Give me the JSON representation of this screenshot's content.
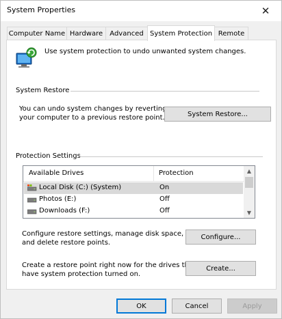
{
  "window": {
    "title": "System Properties",
    "close_glyph": "✕"
  },
  "tabs": [
    {
      "label": "Computer Name",
      "active": false
    },
    {
      "label": "Hardware",
      "active": false
    },
    {
      "label": "Advanced",
      "active": false
    },
    {
      "label": "System Protection",
      "active": true
    },
    {
      "label": "Remote",
      "active": false
    }
  ],
  "intro": {
    "icon": "system-protection-shield-icon",
    "text": "Use system protection to undo unwanted system changes."
  },
  "system_restore": {
    "group_label": "System Restore",
    "description_line1": "You can undo system changes by reverting",
    "description_line2": "your computer to a previous restore point.",
    "button_label": "System Restore..."
  },
  "protection_settings": {
    "group_label": "Protection Settings",
    "columns": [
      "Available Drives",
      "Protection"
    ],
    "drives": [
      {
        "name": "Local Disk (C:) (System)",
        "protection": "On",
        "selected": true,
        "icon": "system-drive-icon"
      },
      {
        "name": "Photos (E:)",
        "protection": "Off",
        "selected": false,
        "icon": "drive-icon"
      },
      {
        "name": "Downloads (F:)",
        "protection": "Off",
        "selected": false,
        "icon": "drive-icon"
      }
    ],
    "configure_text_line1": "Configure restore settings, manage disk space,",
    "configure_text_line2": "and delete restore points.",
    "configure_button": "Configure...",
    "create_text_line1": "Create a restore point right now for the drives that",
    "create_text_line2": "have system protection turned on.",
    "create_button": "Create..."
  },
  "footer": {
    "ok": "OK",
    "cancel": "Cancel",
    "apply": "Apply"
  },
  "colors": {
    "accent": "#0078d7",
    "selected_row": "#d9d9d9"
  }
}
